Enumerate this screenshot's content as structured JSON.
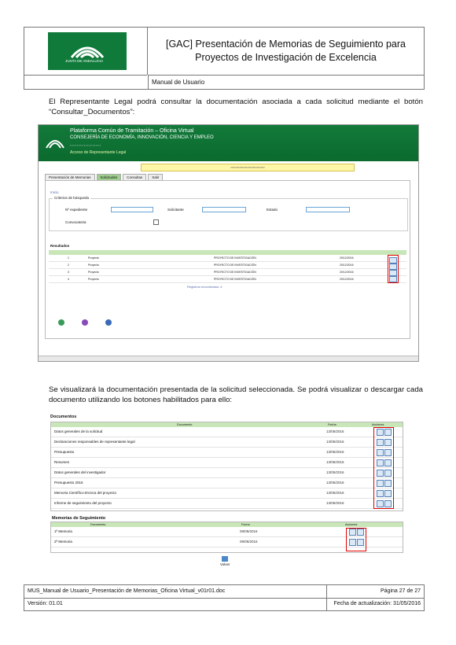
{
  "header": {
    "logo_text": "JUNTA DE ANDALUCIA",
    "title_line1": "[GAC] Presentación de Memorias de Seguimiento para",
    "title_line2": "Proyectos de Investigación de Excelencia",
    "subtitle": "Manual de Usuario"
  },
  "paragraph1": "El Representante Legal podrá consultar la documentación asociada a cada solicitud mediante el botón “Consultar_Documentos”:",
  "screenshot1": {
    "banner": {
      "line1": "Plataforma Común de Tramitación – Oficina Virtual",
      "line2": "CONSEJERÍA DE ECONOMÍA, INNOVACIÓN, CIENCIA Y EMPLEO",
      "line4": "Acceso de Representante Legal"
    },
    "tabs": [
      "Presentación de Memorias",
      "Solicitudes",
      "Consultas",
      "Salir"
    ],
    "crumb": "Inicio",
    "fieldset_legend": "Criterios de búsqueda",
    "labels": {
      "expediente": "Nº expediente",
      "solicitante": "Solicitante",
      "estado": "Estado",
      "convocatoria": "Convocatoria"
    },
    "table_title": "Resultados",
    "rows": [
      {
        "id": "1",
        "type": "Proyecto",
        "title": "PROYECTO DE INVESTIGACIÓN",
        "date": "20/12/2016"
      },
      {
        "id": "2",
        "type": "Proyecto",
        "title": "PROYECTO DE INVESTIGACIÓN",
        "date": "20/12/2016"
      },
      {
        "id": "3",
        "type": "Proyecto",
        "title": "PROYECTO DE INVESTIGACIÓN",
        "date": "20/12/2016"
      },
      {
        "id": "4",
        "type": "Proyecto",
        "title": "PROYECTO DE INVESTIGACIÓN",
        "date": "20/12/2016"
      }
    ],
    "pager": "Registros encontrados: 4"
  },
  "paragraph2": "Se visualizará la documentación presentada de la solicitud seleccionada. Se podrá visualizar o descargar cada documento utilizando los botones habilitados para ello:",
  "screenshot2": {
    "documents_title": "Documentos",
    "documents_header": {
      "name": "Documento",
      "date": "Fecha",
      "actions": "Acciones"
    },
    "documents": [
      {
        "name": "Datos generales de la solicitud",
        "date": "13/05/2016"
      },
      {
        "name": "Declaraciones responsables de representante legal",
        "date": "13/05/2016"
      },
      {
        "name": "Presupuesto",
        "date": "13/05/2016"
      },
      {
        "name": "Resumen",
        "date": "13/05/2016"
      },
      {
        "name": "Datos generales del investigador",
        "date": "13/05/2016"
      },
      {
        "name": "Presupuesto 2016",
        "date": "13/05/2016"
      },
      {
        "name": "Memoria Científico-técnica del proyecto",
        "date": "13/05/2016"
      },
      {
        "name": "Informe de seguimiento del proyecto",
        "date": "13/05/2016"
      }
    ],
    "memorias_title": "Memorias de Seguimiento",
    "memorias_header": {
      "name": "Documento",
      "date": "Fecha",
      "actions": "Acciones"
    },
    "memorias": [
      {
        "name": "1ª Memoria",
        "date": "09/05/2016"
      },
      {
        "name": "2ª Memoria",
        "date": "09/05/2016"
      }
    ],
    "volver": "Volver"
  },
  "footer": {
    "doc_name": "MUS_Manual de Usuario_Presentación de Memorias_Oficina Virtual_v01r01.doc",
    "page": "Página 27 de 27",
    "version": "Versión: 01.01",
    "updated": "Fecha de actualización: 31/05/2016"
  }
}
